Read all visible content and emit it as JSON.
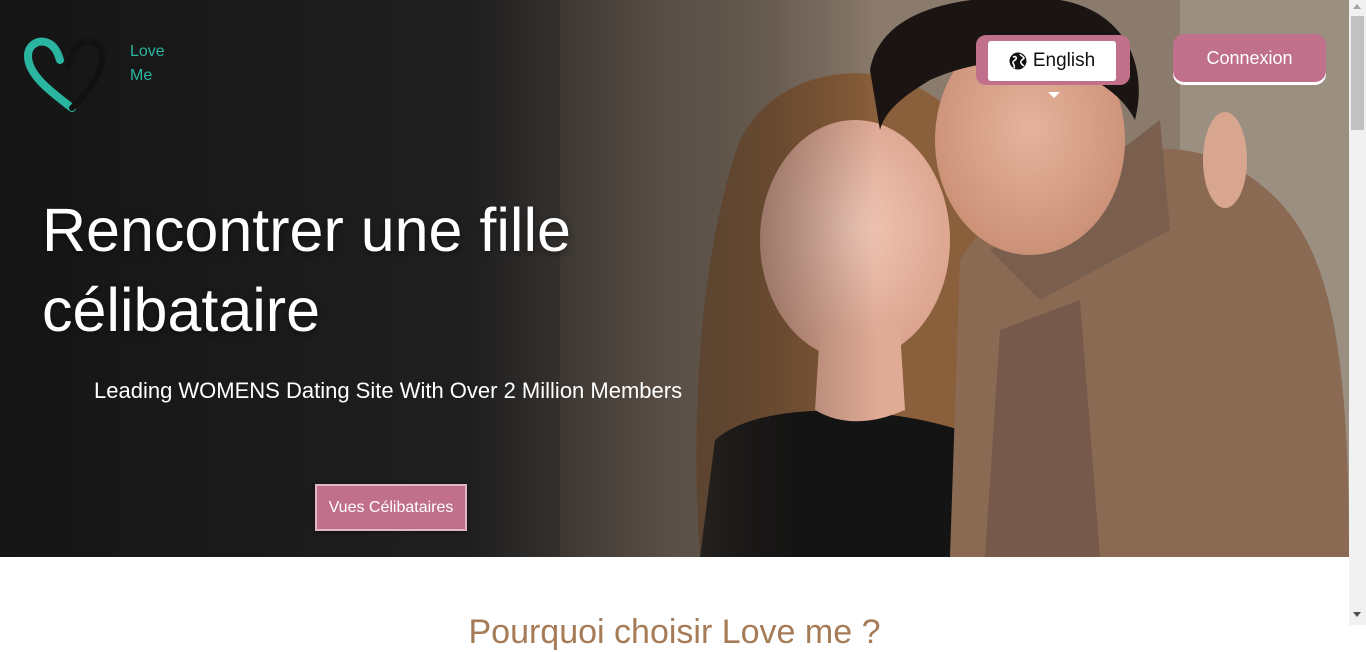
{
  "brand": {
    "line1": "Love",
    "line2": "Me"
  },
  "header": {
    "language_label": "English",
    "login_label": "Connexion"
  },
  "hero": {
    "title_line1": "Rencontrer une fille",
    "title_line2": "célibataire",
    "subtitle": "Leading WOMENS Dating Site With Over 2 Million Members",
    "cta_label": "Vues Célibataires"
  },
  "section": {
    "heading": "Pourquoi choisir Love me ?"
  },
  "icons": {
    "logo": "heart-logo-icon",
    "language": "globe-icon",
    "caret": "caret-down-icon"
  },
  "colors": {
    "accent": "#c0708a",
    "brand_teal": "#2ab5a0",
    "heading_brown": "#a67c58"
  }
}
